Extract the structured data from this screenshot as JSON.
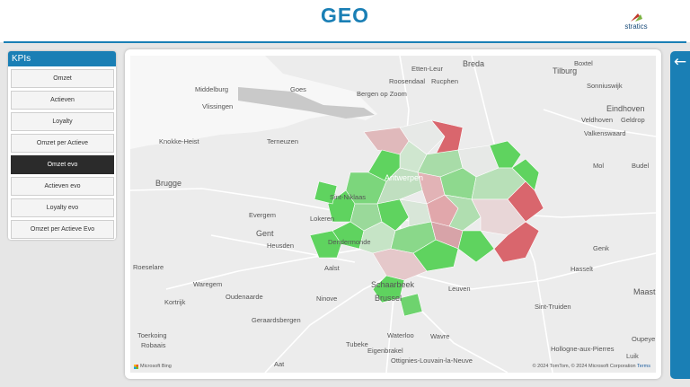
{
  "header": {
    "title": "GEO",
    "logo_text": "stratics"
  },
  "kpi": {
    "title": "KPIs",
    "items": [
      {
        "label": "Omzet"
      },
      {
        "label": "Actieven"
      },
      {
        "label": "Loyalty"
      },
      {
        "label": "Omzet per Actieve"
      },
      {
        "label": "Omzet evo"
      },
      {
        "label": "Actieven evo"
      },
      {
        "label": "Loyalty evo"
      },
      {
        "label": "Omzet per Actieve Evo"
      }
    ],
    "selected": "Omzet evo"
  },
  "map": {
    "places": [
      "Breda",
      "Tilburg",
      "Goes",
      "Middelburg",
      "Vlissingen",
      "Etten-Leur",
      "Roosendaal",
      "Rucphen",
      "Bergen op Zoom",
      "Boxtel",
      "Sonniuswijk",
      "Eindhoven",
      "Veldhoven",
      "Geldrop",
      "Valkenswaard",
      "Knokke-Heist",
      "Brugge",
      "Terneuzen",
      "Antwerpen",
      "Sint-Niklaas",
      "Lokeren",
      "Gent",
      "Evergem",
      "Heusden",
      "Dendermonde",
      "Aalst",
      "Roeselare",
      "Waregem",
      "Oudenaarde",
      "Ninove",
      "Kortrijk",
      "Geraardsbergen",
      "Schaarbeek",
      "Brussel",
      "Leuven",
      "Hasselt",
      "Genk",
      "Maastricht",
      "Sint-Truiden",
      "Tubeke",
      "Eigenbrakel",
      "Waterloo",
      "Wavre",
      "Ottignies-Louvain-la-Neuve",
      "Hollogne-aux-Pierres",
      "Luik",
      "Oupeye",
      "Toerkoing",
      "Robaais",
      "Aat",
      "Budel",
      "Mol"
    ],
    "attribution": "© 2024 TomTom, © 2024 Microsoft Corporation",
    "terms": "Terms",
    "provider": "Microsoft Bing",
    "colors": {
      "positive": "#5fd35f",
      "negative": "#d9666d",
      "neutral": "#e4e8e4"
    }
  },
  "nav": {
    "back_icon": "back-arrow-icon"
  }
}
